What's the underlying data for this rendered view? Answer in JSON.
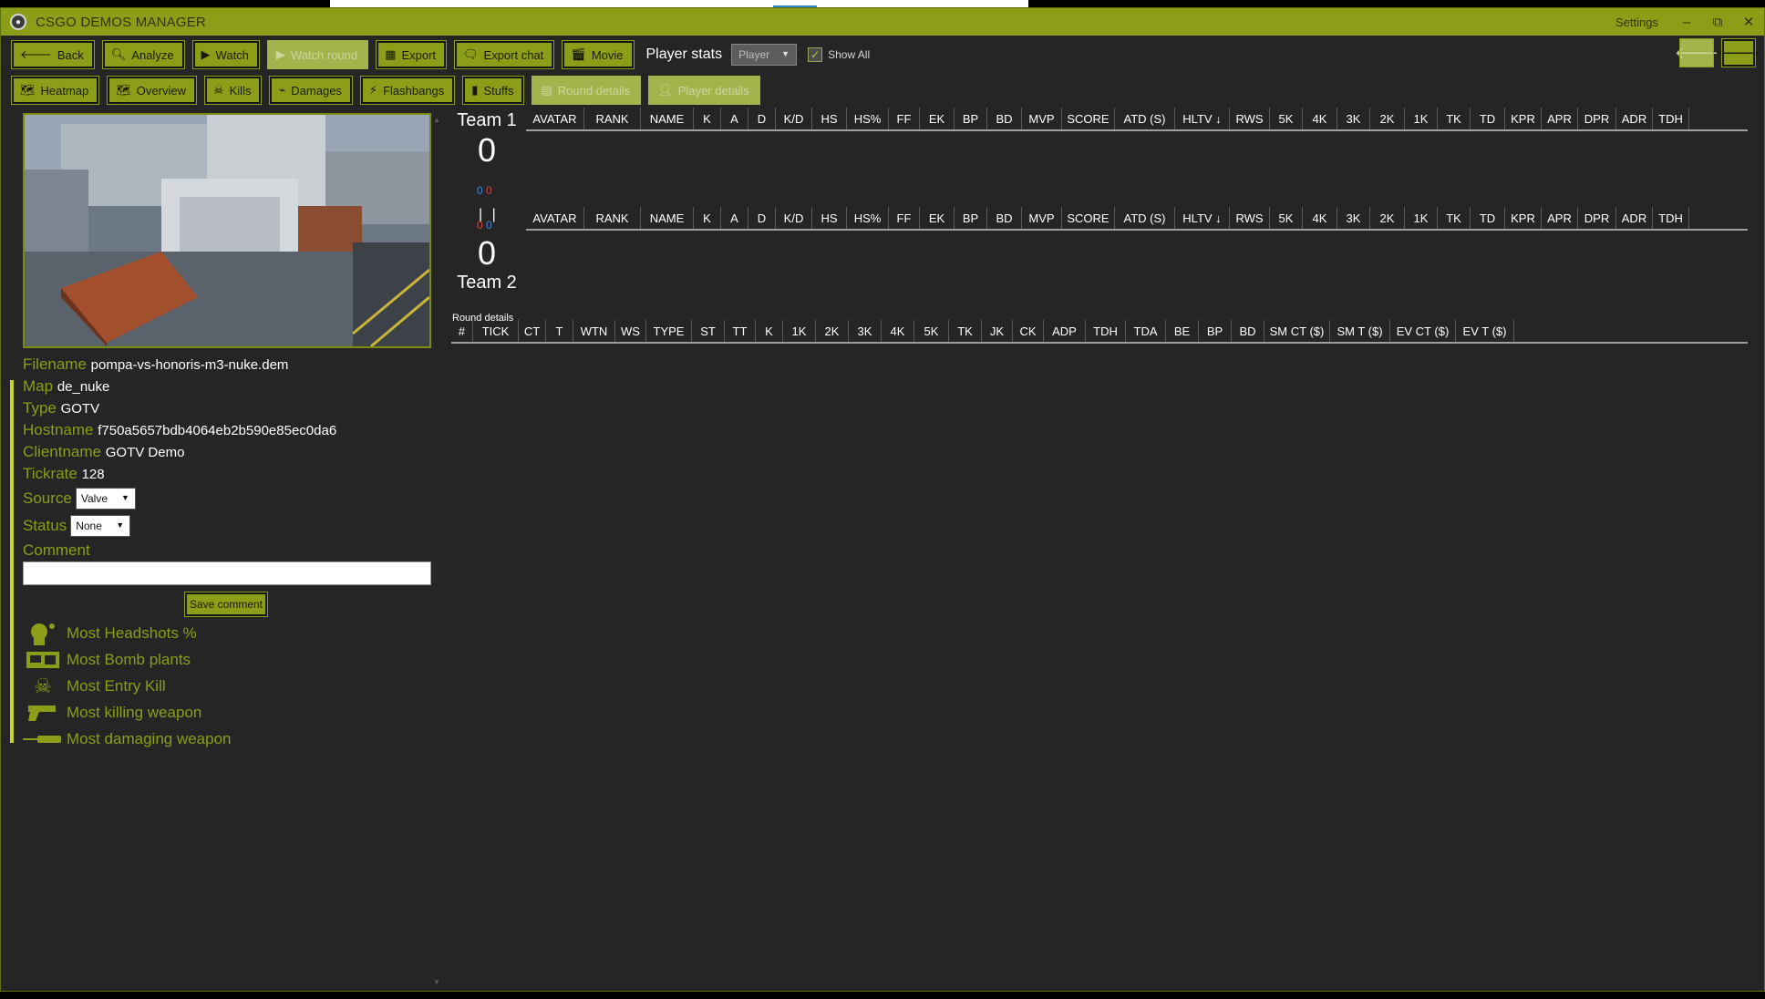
{
  "app": {
    "title": "CSGO DEMOS MANAGER",
    "settings": "Settings",
    "logo": "csgo-logo",
    "accent": "#8c9e18"
  },
  "window_controls": {
    "minimize": "‒",
    "restore": "⧉",
    "close": "✕"
  },
  "toolbar1": {
    "back": "Back",
    "analyze": "Analyze",
    "watch": "Watch",
    "watch_round": "Watch round",
    "export": "Export",
    "export_chat": "Export chat",
    "movie": "Movie",
    "player_stats_label": "Player stats",
    "player_select": "Player",
    "show_all": "Show All"
  },
  "toolbar2": {
    "heatmap": "Heatmap",
    "overview": "Overview",
    "kills": "Kills",
    "damages": "Damages",
    "flashbangs": "Flashbangs",
    "stuffs": "Stuffs",
    "round_details": "Round details",
    "player_details": "Player details"
  },
  "demo": {
    "filename_label": "Filename",
    "filename": "pompa-vs-honoris-m3-nuke.dem",
    "map_label": "Map",
    "map": "de_nuke",
    "type_label": "Type",
    "type": "GOTV",
    "hostname_label": "Hostname",
    "hostname": "f750a5657bdb4064eb2b590e85ec0da6",
    "clientname_label": "Clientname",
    "clientname": "GOTV Demo",
    "tickrate_label": "Tickrate",
    "tickrate": "128",
    "source_label": "Source",
    "source": "Valve",
    "status_label": "Status",
    "status": "None",
    "comment_label": "Comment",
    "comment": "",
    "save_comment": "Save comment"
  },
  "achievements": [
    {
      "icon": "headshot-icon",
      "label": "Most Headshots %"
    },
    {
      "icon": "bomb-icon",
      "label": "Most Bomb plants"
    },
    {
      "icon": "skull-icon",
      "label": "Most Entry Kill"
    },
    {
      "icon": "pistol-icon",
      "label": "Most killing weapon"
    },
    {
      "icon": "knife-icon",
      "label": "Most damaging weapon"
    }
  ],
  "teams": {
    "team1": {
      "name": "Team 1",
      "score": "0",
      "ct": "0",
      "t": "0"
    },
    "team2": {
      "name": "Team 2",
      "score": "0",
      "ct": "0",
      "t": "0"
    },
    "separator": "| |"
  },
  "player_columns": [
    "AVATAR",
    "RANK",
    "NAME",
    "K",
    "A",
    "D",
    "K/D",
    "HS",
    "HS%",
    "FF",
    "EK",
    "BP",
    "BD",
    "MVP",
    "SCORE",
    "ATD (S)",
    "HLTV ↓",
    "RWS",
    "5K",
    "4K",
    "3K",
    "2K",
    "1K",
    "TK",
    "TD",
    "KPR",
    "APR",
    "DPR",
    "ADR",
    "TDH"
  ],
  "round_details_label": "Round details",
  "round_columns": [
    "#",
    "TICK",
    "CT",
    "T",
    "WTN",
    "WS",
    "TYPE",
    "ST",
    "TT",
    "K",
    "1K",
    "2K",
    "3K",
    "4K",
    "5K",
    "TK",
    "JK",
    "CK",
    "ADP",
    "TDH",
    "TDA",
    "BE",
    "BP",
    "BD",
    "SM CT ($)",
    "SM T ($)",
    "EV CT ($)",
    "EV T ($)"
  ]
}
